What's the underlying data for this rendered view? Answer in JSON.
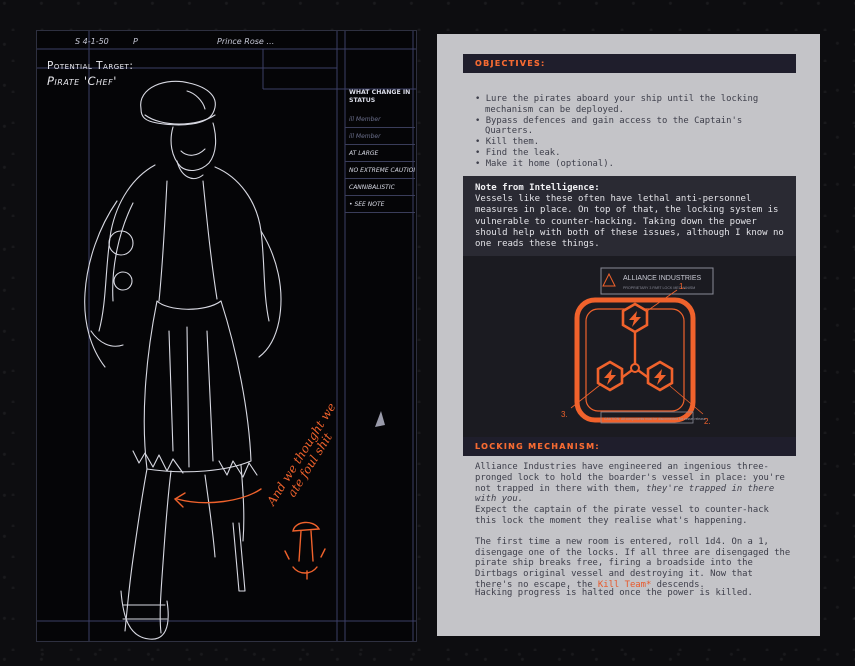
{
  "sketch": {
    "header_scrawl_left": "S 4-1-50",
    "header_scrawl_mid": "P",
    "header_scrawl_right": "Prince Rose …",
    "target_label": "Potential Target:",
    "target_name": "Pirate 'Chef'",
    "status_heading": "WHAT CHANGE IN STATUS",
    "status_rows": [
      "ill Member",
      "ill Member",
      "AT LARGE",
      "NO EXTREME CAUTION",
      "CANNIBALISTIC",
      "• SEE NOTE"
    ],
    "orange_note": [
      "And we thought we",
      "ate foul shit"
    ],
    "accent": "#f0622c"
  },
  "doc": {
    "objectives_heading": "OBJECTIVES:",
    "objectives": [
      "Lure the pirates aboard your ship until the locking mechanism can be deployed.",
      "Bypass defences and gain access to the Captain's Quarters.",
      "Kill them.",
      "Find the leak.",
      "Make it home (optional)."
    ],
    "intel_title": "Note from Intelligence:",
    "intel_body": "Vessels like these often have lethal anti-personnel measures in place. On top of that, the locking system is vulnerable to counter-hacking. Taking down the power should help with both of these issues, although I know no one reads these things.",
    "diagram": {
      "brand": "ALLIANCE INDUSTRIES",
      "brand_sub": "PROPRIETARY 3 PART LOCK MECHANISM",
      "caution": "CAUTION: All components must be disconnected for vessel release",
      "callouts": [
        "1.",
        "2.",
        "3."
      ],
      "color": "#f0622c"
    },
    "lock_heading": "LOCKING MECHANISM:",
    "lock_p1_a": "Alliance Industries have engineered an ingenious three-pronged lock to hold the boarder's vessel in place: you're not trapped in there with them, ",
    "lock_p1_em": "they're trapped in there with you.",
    "lock_p2": "Expect the captain of the pirate vessel to counter-hack this lock the moment they realise what's happening.",
    "lock_p3_a": "The first time a new room is entered, roll 1d4. On a 1, disengage one of the locks. If all three are disengaged the pirate ship breaks free, firing a broadside into the Dirtbags original vessel and destroying it. Now that there's no escape, the ",
    "lock_p3_kill": "Kill Team*",
    "lock_p3_b": " descends.",
    "halt": "Hacking progress is halted once the power is killed.",
    "accent": "#f46a32",
    "bar_color": "#1f1e2c"
  }
}
